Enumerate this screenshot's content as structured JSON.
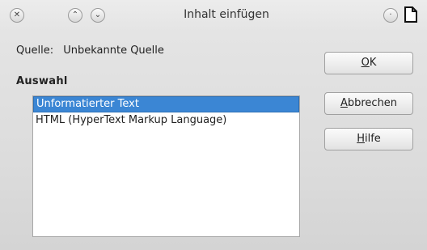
{
  "window": {
    "title": "Inhalt einfügen"
  },
  "titlebar_icons": [
    "close-icon",
    "minimize-icon",
    "maximize-icon",
    "menu-icon",
    "document-icon"
  ],
  "source": {
    "label": "Quelle:",
    "value": "Unbekannte Quelle"
  },
  "selection": {
    "label": "Auswahl",
    "items": [
      {
        "label": "Unformatierter Text",
        "selected": true
      },
      {
        "label": "HTML (HyperText Markup Language)",
        "selected": false
      }
    ]
  },
  "buttons": {
    "ok": {
      "mnemonic": "O",
      "rest": "K"
    },
    "cancel": {
      "mnemonic": "A",
      "rest": "bbrechen"
    },
    "help": {
      "mnemonic": "H",
      "rest": "ilfe"
    }
  },
  "colors": {
    "selection_bg": "#3b86d4",
    "window_bg": "#e4e4e4"
  }
}
